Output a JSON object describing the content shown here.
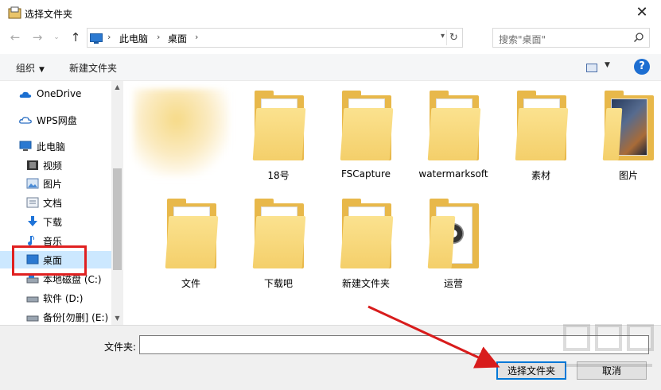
{
  "window": {
    "title": "选择文件夹"
  },
  "address": {
    "breadcrumbs": [
      "此电脑",
      "桌面"
    ],
    "search_placeholder": "搜索\"桌面\""
  },
  "toolbar": {
    "organize": "组织",
    "new_folder": "新建文件夹"
  },
  "nav": [
    {
      "label": "OneDrive",
      "icon": "cloud-icon"
    },
    {
      "label": "WPS网盘",
      "icon": "cloud-outline-icon"
    },
    {
      "label": "此电脑",
      "icon": "computer-icon"
    },
    {
      "label": "视频",
      "icon": "video-icon"
    },
    {
      "label": "图片",
      "icon": "picture-icon"
    },
    {
      "label": "文档",
      "icon": "document-icon"
    },
    {
      "label": "下载",
      "icon": "download-arrow-icon"
    },
    {
      "label": "音乐",
      "icon": "music-note-icon"
    },
    {
      "label": "桌面",
      "icon": "desktop-icon"
    },
    {
      "label": "本地磁盘 (C:)",
      "icon": "drive-icon"
    },
    {
      "label": "软件 (D:)",
      "icon": "drive-icon"
    },
    {
      "label": "备份[勿删] (E:)",
      "icon": "drive-icon"
    }
  ],
  "folders": [
    {
      "name": "18号"
    },
    {
      "name": "FSCapture"
    },
    {
      "name": "watermarksoft"
    },
    {
      "name": "素材"
    },
    {
      "name": "图片"
    },
    {
      "name": "文件"
    },
    {
      "name": "下载吧"
    },
    {
      "name": "新建文件夹"
    },
    {
      "name": "运营"
    }
  ],
  "footer": {
    "folder_label": "文件夹:",
    "folder_value": "",
    "select_button": "选择文件夹",
    "cancel_button": "取消"
  },
  "colors": {
    "accent": "#0078d7",
    "highlight_box": "#e02020",
    "folder": "#f4cf6a",
    "selection": "#cce8ff"
  }
}
